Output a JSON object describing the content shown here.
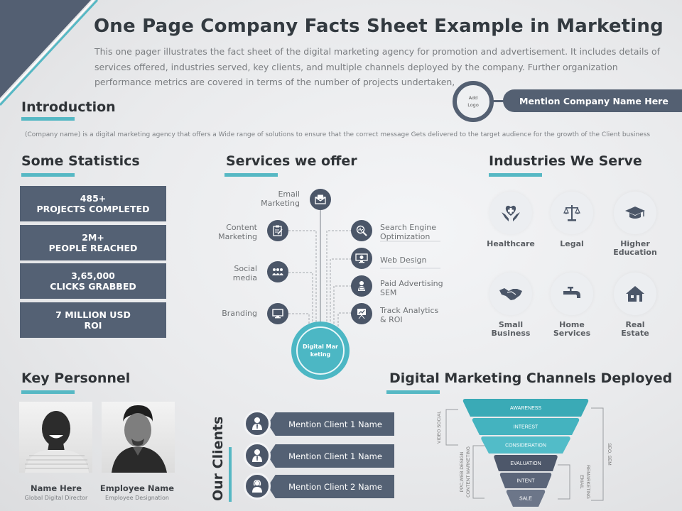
{
  "header": {
    "title": "One Page Company Facts Sheet Example in Marketing",
    "subtitle": "This one pager illustrates the fact sheet of the digital marketing agency for promotion and advertisement. It includes details of services offered, industries served, key clients, and multiple channels deployed by the company. Further organization performance metrics are covered in terms of the number of projects undertaken,",
    "logo_placeholder": "Add Logo",
    "company_name": "Mention Company Name Here"
  },
  "colors": {
    "navy": "#546174",
    "teal": "#56b8c4",
    "dark_text": "#2f3337"
  },
  "introduction": {
    "heading": "Introduction",
    "text": "(Company name) is a digital marketing agency that offers a Wide range of solutions to ensure that the correct message Gets delivered to the target audience for the growth of the Client business"
  },
  "statistics": {
    "heading": "Some Statistics",
    "items": [
      {
        "value": "485+",
        "label": "PROJECTS COMPLETED"
      },
      {
        "value": "2M+",
        "label": "PEOPLE REACHED"
      },
      {
        "value": "3,65,000",
        "label": "CLICKS GRABBED"
      },
      {
        "value": "7 MILLION USD",
        "label": "ROI"
      }
    ]
  },
  "services": {
    "heading": "Services we offer",
    "center": "Digital Marketing",
    "items": [
      {
        "label_1": "Email",
        "label_2": "Marketing",
        "icon": "email-icon"
      },
      {
        "label_1": "Content",
        "label_2": "Marketing",
        "icon": "clipboard-edit-icon"
      },
      {
        "label_1": "Social",
        "label_2": "media",
        "icon": "people-group-icon"
      },
      {
        "label_1": "Branding",
        "label_2": "",
        "icon": "monitor-icon"
      },
      {
        "label_1": "Search Engine",
        "label_2": "Optimization",
        "icon": "search-analytics-icon"
      },
      {
        "label_1": "Web Design",
        "label_2": "",
        "icon": "web-design-icon"
      },
      {
        "label_1": "Paid Advertising",
        "label_2": "SEM",
        "icon": "advertiser-icon"
      },
      {
        "label_1": "Track Analytics",
        "label_2": "& ROI",
        "icon": "presentation-chart-icon"
      }
    ]
  },
  "industries": {
    "heading": "Industries We Serve",
    "items": [
      {
        "label_1": "Healthcare",
        "label_2": "",
        "icon": "heart-hands-icon"
      },
      {
        "label_1": "Legal",
        "label_2": "",
        "icon": "scales-icon"
      },
      {
        "label_1": "Higher",
        "label_2": "Education",
        "icon": "graduation-cap-icon"
      },
      {
        "label_1": "Small",
        "label_2": "Business",
        "icon": "handshake-icon"
      },
      {
        "label_1": "Home",
        "label_2": "Services",
        "icon": "faucet-icon"
      },
      {
        "label_1": "Real Estate",
        "label_2": "",
        "icon": "house-icon"
      }
    ]
  },
  "personnel": {
    "heading": "Key Personnel",
    "people": [
      {
        "name": "Name Here",
        "role": "Global Digital Director"
      },
      {
        "name": "Employee Name",
        "role": "Employee Designation"
      }
    ]
  },
  "clients": {
    "heading": "Our Clients",
    "items": [
      {
        "name": "Mention Client 1 Name"
      },
      {
        "name": "Mention Client 1 Name"
      },
      {
        "name": "Mention Client 2 Name"
      }
    ]
  },
  "channels": {
    "heading": "Digital Marketing Channels Deployed",
    "funnel": [
      "AWARENESS",
      "INTEREST",
      "CONSIDERATION",
      "EVALUATION",
      "INTENT",
      "SALE"
    ],
    "left_brackets": [
      {
        "label_1": "VIDEO SOCIAL",
        "label_2": ""
      },
      {
        "label_1": "PPC,WEB DESIGN",
        "label_2": "CONTENT MARKETING"
      }
    ],
    "right_brackets": [
      {
        "label_1": "SEO, SEM",
        "label_2": ""
      },
      {
        "label_1": "EMAIL",
        "label_2": "REMARKETING"
      }
    ]
  }
}
